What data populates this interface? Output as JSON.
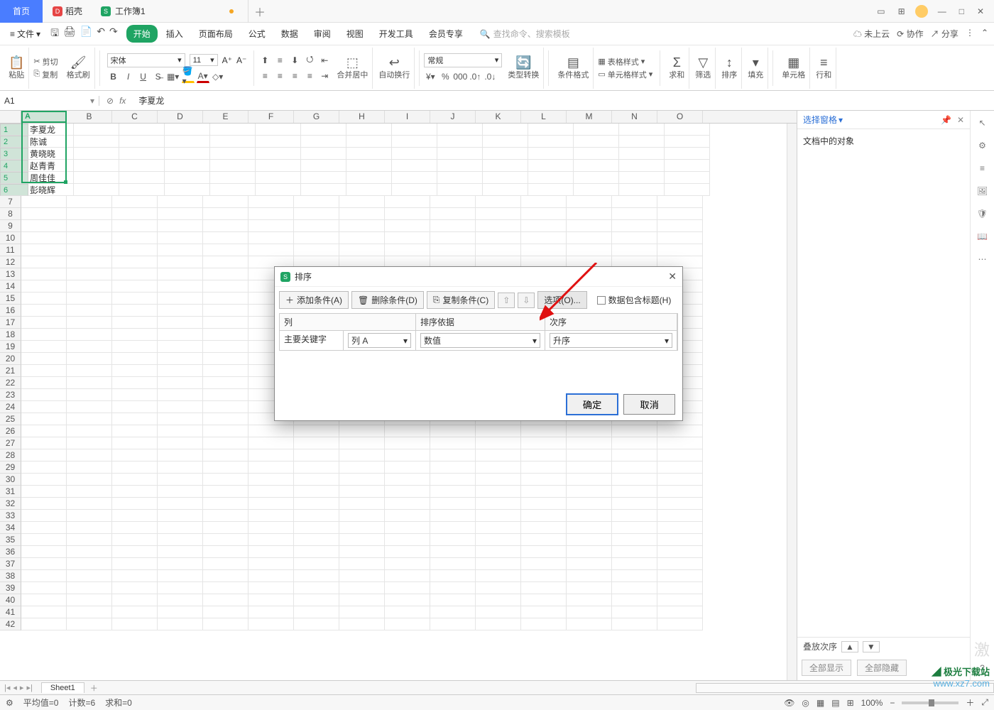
{
  "titlebar": {
    "home": "首页",
    "shell": "稻壳",
    "workbook": "工作簿1"
  },
  "win": {
    "minimize": "—",
    "restore": "□",
    "close": "✕"
  },
  "menu": {
    "file": "文件",
    "tabs": [
      "开始",
      "插入",
      "页面布局",
      "公式",
      "数据",
      "审阅",
      "视图",
      "开发工具",
      "会员专享"
    ],
    "search_placeholder": "查找命令、搜索模板",
    "cloud": "未上云",
    "collab": "协作",
    "share": "分享"
  },
  "ribbon": {
    "paste": "粘贴",
    "cut": "剪切",
    "copy": "复制",
    "format_painter": "格式刷",
    "font": "宋体",
    "size": "11",
    "merge": "合并居中",
    "wrap": "自动换行",
    "numfmt": "常规",
    "type_convert": "类型转换",
    "cond": "条件格式",
    "tbl_style": "表格样式",
    "cell_style": "单元格样式",
    "sum": "求和",
    "filter": "筛选",
    "sort": "排序",
    "fill": "填充",
    "cells": "单元格",
    "rows": "行和"
  },
  "fx": {
    "name": "A1",
    "formula": "李夏龙"
  },
  "columns": [
    "A",
    "B",
    "C",
    "D",
    "E",
    "F",
    "G",
    "H",
    "I",
    "J",
    "K",
    "L",
    "M",
    "N",
    "O"
  ],
  "rowcount": 42,
  "data_col_a": [
    "李夏龙",
    "陈诚",
    "黄晓晓",
    "赵青青",
    "周佳佳",
    "彭晓辉"
  ],
  "side": {
    "title": "选择窗格",
    "section": "文档中的对象",
    "stack": "叠放次序",
    "show_all": "全部显示",
    "hide_all": "全部隐藏"
  },
  "sheets": {
    "tab": "Sheet1"
  },
  "status": {
    "avg": "平均值=0",
    "count": "计数=6",
    "sum": "求和=0",
    "zoom": "100%"
  },
  "dialog": {
    "title": "排序",
    "add": "添加条件(A)",
    "del": "删除条件(D)",
    "copy": "复制条件(C)",
    "options": "选项(O)...",
    "has_header": "数据包含标题(H)",
    "hdr_col": "列",
    "hdr_by": "排序依据",
    "hdr_ord": "次序",
    "key_label": "主要关键字",
    "key_val": "列 A",
    "by_val": "数值",
    "ord_val": "升序",
    "ok": "确定",
    "cancel": "取消"
  },
  "watermark": {
    "l1": "极光下载站",
    "l2": "www.xz7.com"
  },
  "activate": "激"
}
